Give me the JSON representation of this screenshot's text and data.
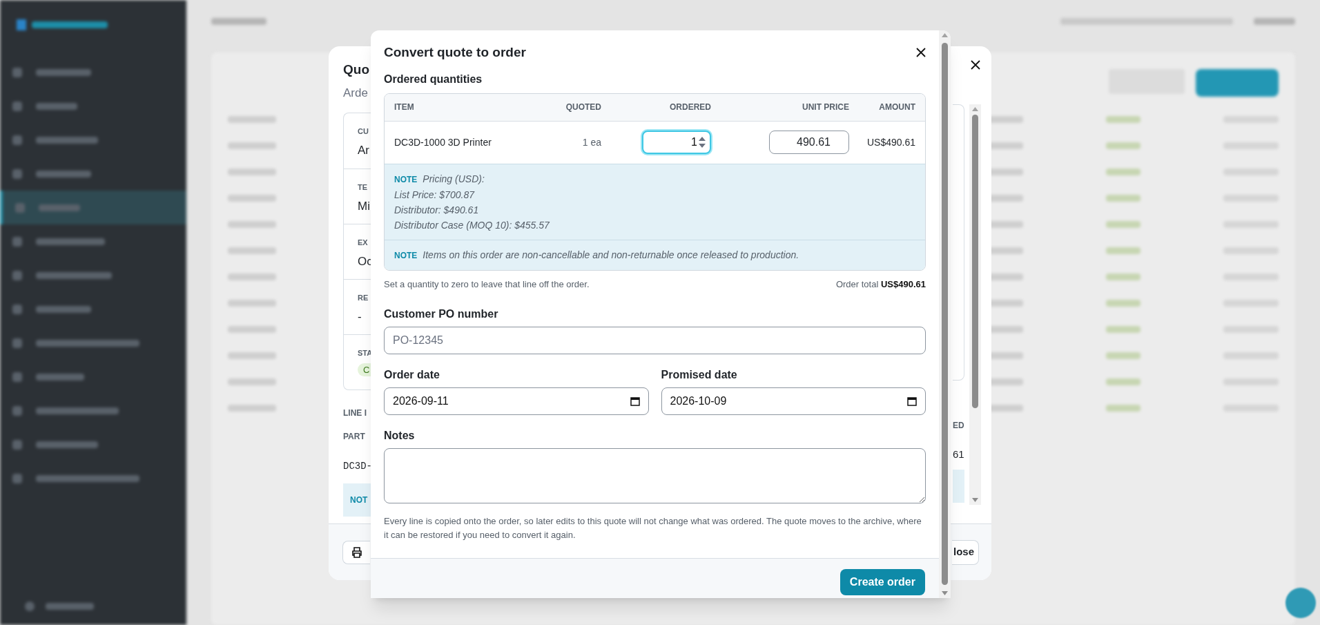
{
  "background_dialog": {
    "title": "Quo",
    "subtitle": "Arde",
    "fields": [
      {
        "label": "CU",
        "value": "Ar",
        "kind": "text"
      },
      {
        "label": "TE",
        "value": "Mi",
        "kind": "text"
      },
      {
        "label": "EX",
        "value": "Oc",
        "kind": "text"
      },
      {
        "label": "RE",
        "value": "-",
        "kind": "text"
      },
      {
        "label": "STA",
        "value": "C",
        "kind": "badge"
      }
    ],
    "section": "LINE I",
    "columns": [
      "PART",
      "ED"
    ],
    "cells": [
      "DC3D-",
      "61"
    ],
    "note": "NOT",
    "close_button": "lose"
  },
  "dialog": {
    "title": "Convert quote to order",
    "section": "Ordered quantities",
    "columns": [
      "ITEM",
      "QUOTED",
      "ORDERED",
      "UNIT PRICE",
      "AMOUNT"
    ],
    "rows": [
      {
        "item": "DC3D-1000 3D Printer",
        "quoted": "1 ea",
        "ordered": "1",
        "focused": true,
        "unit_price": "490.61",
        "amount": "US$490.61"
      }
    ],
    "notes": [
      {
        "label": "NOTE",
        "lines": [
          "Pricing (USD):",
          "List Price: $700.87",
          "Distributor: $490.61",
          "Distributor Case (MOQ 10): $455.57"
        ]
      },
      {
        "label": "NOTE",
        "lines": [
          "Items on this order are non-cancellable and non-returnable once released to production."
        ]
      }
    ],
    "hint": "Set a quantity to zero to leave that line off the order.",
    "total_label": "Order total",
    "total": "US$490.61",
    "po": {
      "label": "Customer PO number",
      "placeholder": "PO-12345"
    },
    "order_date": {
      "label": "Order date",
      "value": "2026-09-11"
    },
    "promised_date": {
      "label": "Promised date",
      "value": "2026-10-09"
    },
    "notes_field": {
      "label": "Notes"
    },
    "footer_text": "Every line is copied onto the order, so later edits to this quote will not change what was ordered. The quote moves to the archive, where it can be restored if you need to convert it again.",
    "submit": "Create order"
  }
}
